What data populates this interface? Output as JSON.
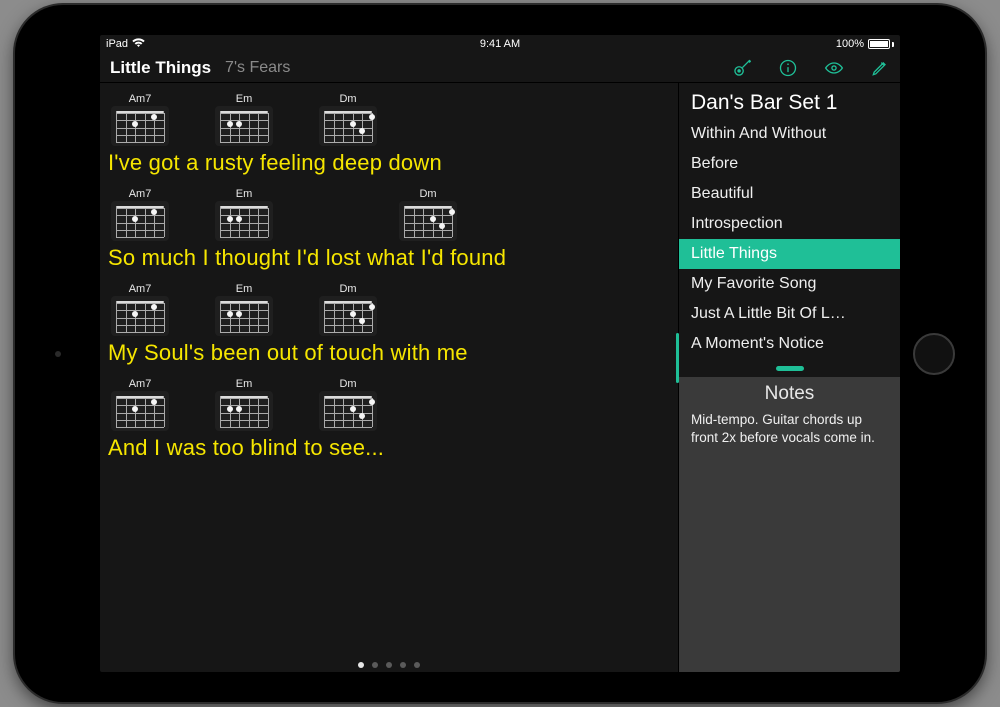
{
  "status": {
    "device": "iPad",
    "time": "9:41 AM",
    "battery_pct": "100%"
  },
  "header": {
    "song_title": "Little Things",
    "artist": "7's Fears",
    "icons": [
      "guitar-icon",
      "info-icon",
      "eye-icon",
      "pencil-icon"
    ]
  },
  "lyrics_pane": {
    "rows": [
      {
        "chords": [
          "Am7",
          "Em",
          "Dm"
        ],
        "lyric": "I've got a rusty feeling deep down"
      },
      {
        "chords": [
          "Am7",
          "Em",
          "Dm"
        ],
        "lyric": "So much I thought I'd lost what I'd found"
      },
      {
        "chords": [
          "Am7",
          "Em",
          "Dm"
        ],
        "lyric": "My Soul's been out of touch with me"
      },
      {
        "chords": [
          "Am7",
          "Em",
          "Dm"
        ],
        "lyric": "And I was too blind to see..."
      }
    ],
    "page_count": 5,
    "page_active": 0
  },
  "sidebar": {
    "set_title": "Dan's Bar Set 1",
    "songs": [
      "Within And Without",
      "Before",
      "Beautiful",
      "Introspection",
      "Little Things",
      "My Favorite Song",
      "Just A Little Bit Of L…",
      "A Moment's Notice"
    ],
    "selected_index": 4,
    "notes_title": "Notes",
    "notes_body": "Mid-tempo. Guitar chords up front 2x before vocals come in."
  },
  "colors": {
    "accent": "#1fbf97",
    "lyric": "#f6e600",
    "bg": "#161616"
  },
  "chord_shapes": {
    "Am7": [
      [
        1,
        1
      ],
      [
        3,
        2
      ]
    ],
    "Em": [
      [
        4,
        2
      ],
      [
        3,
        2
      ]
    ],
    "Dm": [
      [
        0,
        1
      ],
      [
        2,
        2
      ],
      [
        1,
        3
      ]
    ]
  }
}
